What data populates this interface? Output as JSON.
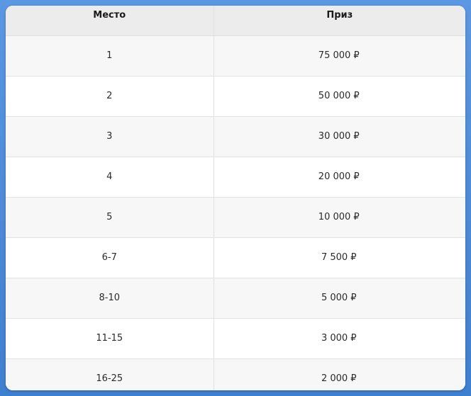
{
  "table": {
    "headers": {
      "place": "Место",
      "prize": "Приз"
    },
    "rows": [
      {
        "place": "1",
        "prize": "75 000 ₽"
      },
      {
        "place": "2",
        "prize": "50 000 ₽"
      },
      {
        "place": "3",
        "prize": "30 000 ₽"
      },
      {
        "place": "4",
        "prize": "20 000 ₽"
      },
      {
        "place": "5",
        "prize": "10 000 ₽"
      },
      {
        "place": "6-7",
        "prize": "7 500 ₽"
      },
      {
        "place": "8-10",
        "prize": "5 000 ₽"
      },
      {
        "place": "11-15",
        "prize": "3 000 ₽"
      },
      {
        "place": "16-25",
        "prize": "2 000 ₽"
      }
    ]
  },
  "colors": {
    "background": "#4a88d6",
    "header_bg": "#ececec",
    "row_alt_bg": "#f7f7f7"
  }
}
